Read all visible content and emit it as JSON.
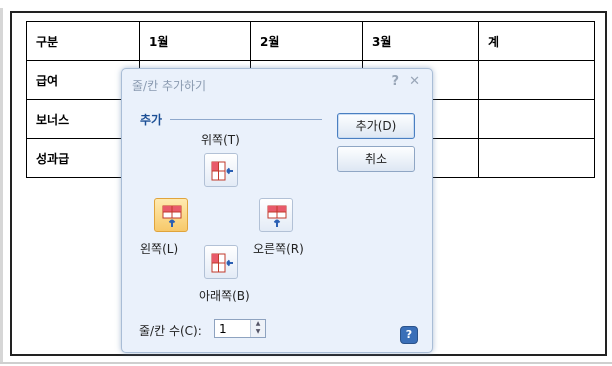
{
  "table": {
    "rows": [
      [
        "구분",
        "1월",
        "2월",
        "3월",
        "계"
      ],
      [
        "급여",
        "",
        "",
        "",
        ""
      ],
      [
        "보너스",
        "",
        "",
        "",
        ""
      ],
      [
        "성과급",
        "",
        "",
        "",
        ""
      ]
    ]
  },
  "dialog": {
    "title": "줄/칸 추가하기",
    "help_glyph": "?",
    "close_glyph": "✕",
    "group_label": "추가",
    "above_label": "위쪽(T)",
    "left_label": "왼쪽(L)",
    "right_label": "오른쪽(R)",
    "below_label": "아래쪽(B)",
    "add_button": "추가(D)",
    "cancel_button": "취소",
    "count_label": "줄/칸 수(C):",
    "count_value": "1",
    "selected_direction": "left",
    "help_button_glyph": "?"
  },
  "colors": {
    "dialog_bg": "#eaf1fb",
    "selected_bg": "#f7c96a",
    "accent_blue": "#1c4f95",
    "cell_fill": "#e85a6a",
    "arrow": "#2a5fb3"
  }
}
